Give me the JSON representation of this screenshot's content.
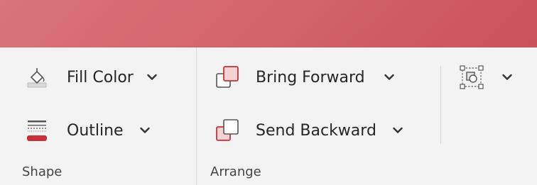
{
  "groups": {
    "shape": {
      "label": "Shape",
      "fill_color": {
        "label": "Fill Color",
        "icon": "paint-bucket-icon"
      },
      "outline": {
        "label": "Outline",
        "icon": "shape-outline-icon",
        "accent": "#c8313a"
      }
    },
    "arrange": {
      "label": "Arrange",
      "bring_forward": {
        "label": "Bring Forward",
        "icon": "bring-forward-icon"
      },
      "send_backward": {
        "label": "Send Backward",
        "icon": "send-backward-icon"
      },
      "selection_pane": {
        "icon": "selection-pane-icon"
      }
    }
  },
  "colors": {
    "titlebar": "#d5656d",
    "ribbon_bg": "#f3f3f3",
    "accent_red": "#c8313a"
  }
}
